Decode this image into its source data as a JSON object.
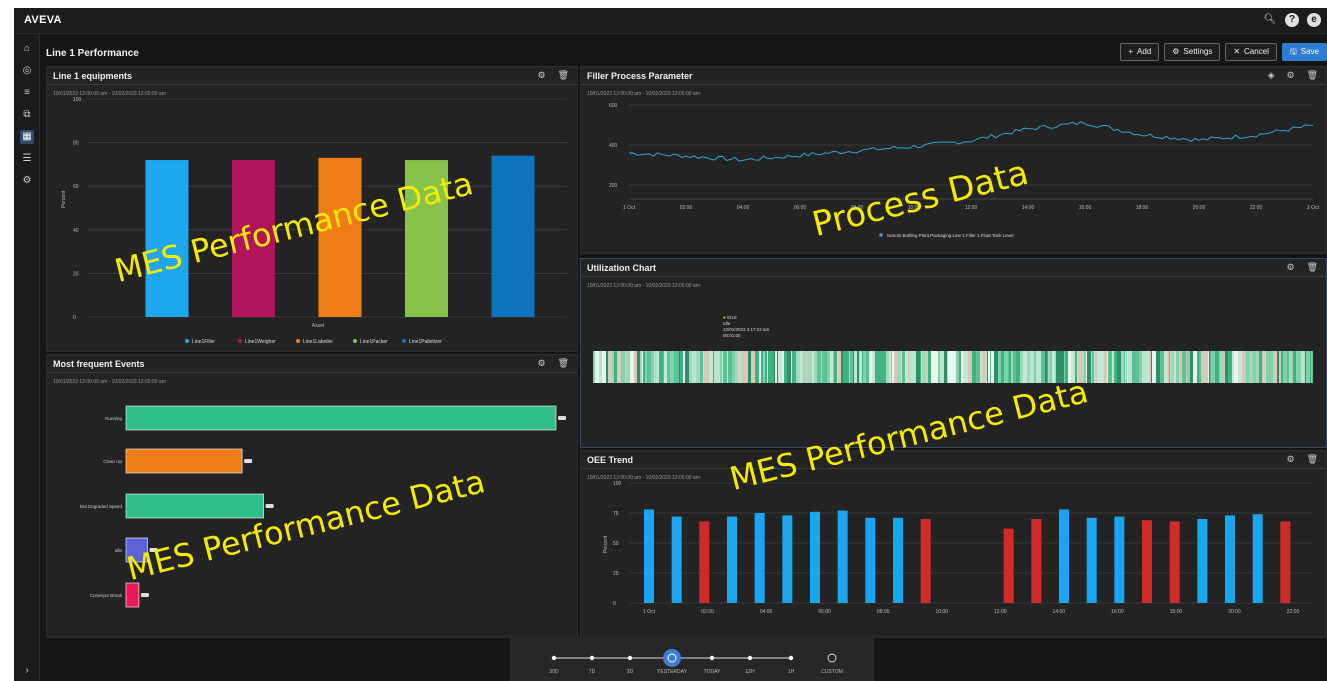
{
  "app": {
    "brand": "AVEVA"
  },
  "page": {
    "title": "Line 1 Performance"
  },
  "toolbar": {
    "add": "Add",
    "settings": "Settings",
    "cancel": "Cancel",
    "save": "Save"
  },
  "panels": {
    "equipments": {
      "title": "Line 1 equipments",
      "daterange": "10/01/2023 12:00:00 am - 10/02/2023 12:00:00 am"
    },
    "filler": {
      "title": "Filler Process Parameter",
      "daterange": "10/01/2023 12:00:00 am - 10/02/2023 12:00:00 am"
    },
    "utilization": {
      "title": "Utilization Chart",
      "daterange": "10/01/2023 12:00:00 am - 10/02/2023 12:00:00 am",
      "tooltip": {
        "line1": "IDLE",
        "line2": "Idle",
        "line3": "10/01/2023 3:17:22 am",
        "line4": "00:01:00"
      }
    },
    "events": {
      "title": "Most frequent Events",
      "daterange": "10/01/2023 12:00:00 am - 10/02/2023 12:00:00 am"
    },
    "oee": {
      "title": "OEE Trend",
      "daterange": "10/01/2023 12:00:00 am - 10/02/2023 12:00:00 am"
    }
  },
  "overlays": {
    "equip": "MES Performance  Data",
    "process": "Process Data",
    "util": "MES Performance Data",
    "events": "MES Performance  Data"
  },
  "timeline": {
    "labels": [
      "30D",
      "7D",
      "3D",
      "YESTERDAY",
      "TODAY",
      "12H",
      "1H",
      "CUSTOM"
    ],
    "selected": "YESTERDAY"
  },
  "chart_data": [
    {
      "type": "bar",
      "title": "Line 1 equipments",
      "categories": [
        "Line1Filler",
        "Line1Weigher",
        "Line1Labeller",
        "Line1Packer",
        "Line1Palletizer"
      ],
      "values": [
        72,
        72,
        73,
        72,
        74
      ],
      "colors": [
        "#1ea6ef",
        "#b0145a",
        "#f07c18",
        "#86c34a",
        "#0e74c0"
      ],
      "xlabel": "Asset",
      "ylabel": "Percent",
      "ylim": [
        0,
        100
      ],
      "yticks": [
        0,
        20,
        40,
        60,
        80,
        100
      ],
      "legend": "bottom"
    },
    {
      "type": "line",
      "title": "Filler Process Parameter",
      "x": [
        "1 Oct",
        "02:00",
        "04:00",
        "06:00",
        "08:00",
        "10:00",
        "12:00",
        "14:00",
        "16:00",
        "18:00",
        "20:00",
        "22:00",
        "2 Oct"
      ],
      "series": [
        {
          "name": "Nanolo Bottling Plant.Packaging.Line 1.Filler 1.Float Tank Level",
          "values": [
            360,
            345,
            325,
            348,
            372,
            392,
            422,
            480,
            512,
            452,
            425,
            450,
            498
          ],
          "color": "#2aa7d6"
        }
      ],
      "ylim": [
        200,
        600
      ],
      "yticks": [
        200,
        400,
        600
      ],
      "legend": "bottom"
    },
    {
      "type": "bar",
      "orientation": "horizontal",
      "title": "Most frequent Events",
      "categories": [
        "Running",
        "Clean Up",
        "Not Degraded Speed",
        "Idle",
        "Conveyor Break"
      ],
      "values": [
        100,
        27,
        32,
        5,
        3
      ],
      "colors": [
        "#2fbd8a",
        "#f07c18",
        "#2fbd8a",
        "#5a64d6",
        "#e8195a"
      ]
    },
    {
      "type": "bar",
      "title": "OEE Trend",
      "categories": [
        "1 Oct",
        "02:00",
        "04:00",
        "06:00",
        "08:00",
        "10:00",
        "12:00",
        "14:00",
        "16:00",
        "18:00",
        "20:00",
        "22:00"
      ],
      "values": [
        78,
        72,
        68,
        72,
        75,
        73,
        76,
        77,
        71,
        71,
        70,
        null,
        null,
        62,
        70,
        78,
        71,
        72,
        69,
        68,
        70,
        73,
        74,
        68
      ],
      "colors": [
        "#19a6ee",
        "#19a6ee",
        "#d12a2a",
        "#19a6ee",
        "#19a6ee",
        "#19a6ee",
        "#19a6ee",
        "#19a6ee",
        "#19a6ee",
        "#19a6ee",
        "#d12a2a",
        null,
        null,
        "#d12a2a",
        "#d12a2a",
        "#19a6ee",
        "#19a6ee",
        "#19a6ee",
        "#d12a2a",
        "#d12a2a",
        "#19a6ee",
        "#19a6ee",
        "#19a6ee",
        "#d12a2a"
      ],
      "ylabel": "Percent",
      "ylim": [
        0,
        100
      ],
      "yticks": [
        0,
        25,
        50,
        75,
        100
      ]
    }
  ]
}
